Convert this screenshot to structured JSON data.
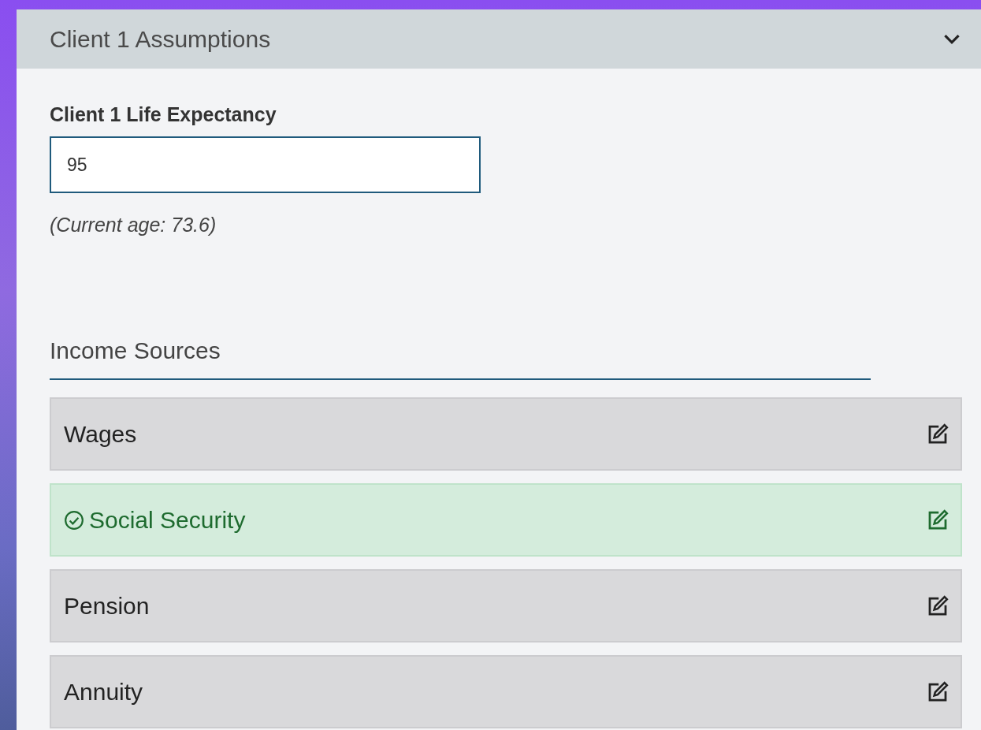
{
  "panel": {
    "title": "Client 1 Assumptions",
    "expanded": true
  },
  "life_expectancy": {
    "label": "Client 1 Life Expectancy",
    "value": "95",
    "note": "(Current age: 73.6)"
  },
  "income_sources": {
    "heading": "Income Sources",
    "items": [
      {
        "label": "Wages",
        "completed": false
      },
      {
        "label": "Social Security",
        "completed": true
      },
      {
        "label": "Pension",
        "completed": false
      },
      {
        "label": "Annuity",
        "completed": false
      }
    ]
  }
}
